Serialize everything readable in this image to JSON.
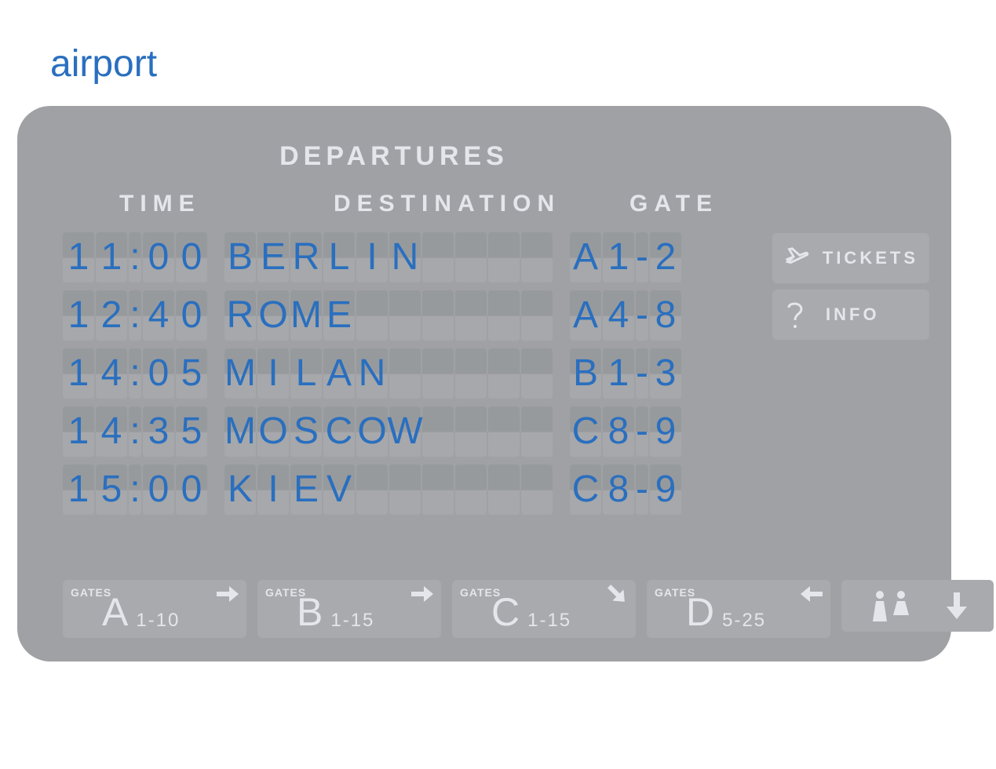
{
  "page_title": "airport",
  "board_title": "DEPARTURES",
  "columns": {
    "time": "TIME",
    "destination": "DESTINATION",
    "gate": "GATE"
  },
  "flights": [
    {
      "time": "11:00",
      "destination": "BERLIN",
      "gate": "A1-2"
    },
    {
      "time": "12:40",
      "destination": "ROME",
      "gate": "A4-8"
    },
    {
      "time": "14:05",
      "destination": "MILAN",
      "gate": "B1-3"
    },
    {
      "time": "14:35",
      "destination": "MOSCOW",
      "gate": "C8-9"
    },
    {
      "time": "15:00",
      "destination": "KIEV",
      "gate": "C8-9"
    }
  ],
  "destination_tile_count": 10,
  "side_buttons": {
    "tickets": "TICKETS",
    "info": "INFO"
  },
  "gate_signs_prefix": "GATES",
  "gate_signs": [
    {
      "letter": "A",
      "range": "1-10",
      "dir": "right"
    },
    {
      "letter": "B",
      "range": "1-15",
      "dir": "right"
    },
    {
      "letter": "C",
      "range": "1-15",
      "dir": "down-right"
    },
    {
      "letter": "D",
      "range": "5-25",
      "dir": "left"
    }
  ],
  "icons": {
    "tickets": "plane-icon",
    "info": "question-icon",
    "restroom": "restroom-icon",
    "down": "arrow-down-icon"
  },
  "chart_data": {
    "type": "table",
    "title": "DEPARTURES",
    "columns": [
      "TIME",
      "DESTINATION",
      "GATE"
    ],
    "rows": [
      [
        "11:00",
        "BERLIN",
        "A1-2"
      ],
      [
        "12:40",
        "ROME",
        "A4-8"
      ],
      [
        "14:05",
        "MILAN",
        "B1-3"
      ],
      [
        "14:35",
        "MOSCOW",
        "C8-9"
      ],
      [
        "15:00",
        "KIEV",
        "C8-9"
      ]
    ]
  }
}
